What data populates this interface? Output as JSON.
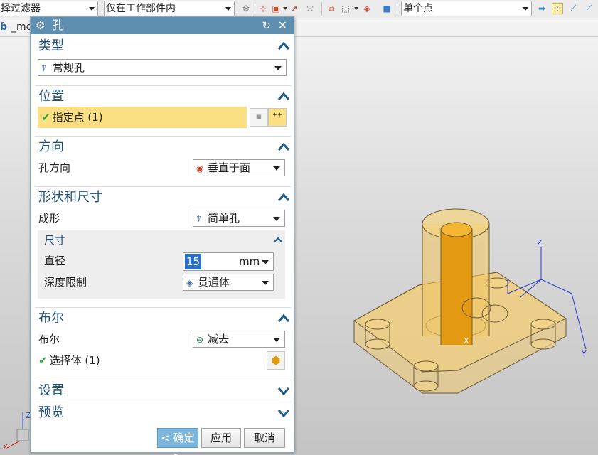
{
  "toolbar": {
    "type_filter": "择过滤器",
    "scope": "仅在工作部件内",
    "snap_mode": "单个点"
  },
  "tab": {
    "label": "_mc"
  },
  "dialog": {
    "title": "孔",
    "sections": {
      "type": {
        "title": "类型",
        "value": "常规孔"
      },
      "position": {
        "title": "位置",
        "specify_point": "指定点 (1)"
      },
      "direction": {
        "title": "方向",
        "label": "孔方向",
        "value": "垂直于面"
      },
      "shape": {
        "title": "形状和尺寸",
        "form_label": "成形",
        "form_value": "简单孔",
        "dims": {
          "title": "尺寸",
          "diameter_label": "直径",
          "diameter_value": "15",
          "diameter_unit": "mm",
          "depth_label": "深度限制",
          "depth_value": "贯通体"
        }
      },
      "boolean": {
        "title": "布尔",
        "label": "布尔",
        "value": "减去",
        "select_body": "选择体 (1)"
      },
      "settings": {
        "title": "设置"
      },
      "preview": {
        "title": "预览"
      }
    },
    "buttons": {
      "ok": "< 确定 >",
      "apply": "应用",
      "cancel": "取消"
    }
  },
  "viewport": {
    "axis_x": "X",
    "axis_y": "Y",
    "axis_z": "Z",
    "triad_x": "X",
    "triad_z": "Z"
  },
  "colors": {
    "title_bar": "#5e8fb0",
    "section_heading": "#1e4f7a",
    "highlight": "#fbe083",
    "model_fill": "#e8b74a",
    "hole_core": "#e39a12"
  }
}
